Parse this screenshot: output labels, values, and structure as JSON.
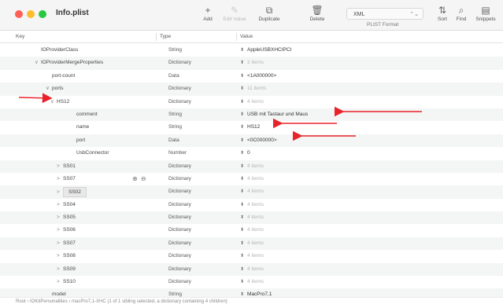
{
  "window": {
    "title": "Info.plist"
  },
  "toolbar": {
    "add": {
      "label": "Add",
      "icon": "+"
    },
    "edit_value": {
      "label": "Edit Value",
      "icon": "✎"
    },
    "duplicate": {
      "label": "Duplicate",
      "icon": "⧉"
    },
    "delete": {
      "label": "Delete",
      "icon": "🗑"
    },
    "format_value": "XML",
    "format_label": "PLIST Format",
    "sort": {
      "label": "Sort",
      "icon": "⇅"
    },
    "find": {
      "label": "Find",
      "icon": "⌕"
    },
    "snippets": {
      "label": "Snippets",
      "icon": "▤"
    }
  },
  "columns": {
    "key": "Key",
    "type": "Type",
    "value": "Value"
  },
  "rows": [
    {
      "key": "IOProviderClass",
      "disclosure": "",
      "type": "String",
      "value": "AppleUSBXHCIPCI",
      "dim": false
    },
    {
      "key": "IOProviderMergeProperties",
      "disclosure": "∨",
      "type": "Dictionary",
      "value": "2 items",
      "dim": true
    },
    {
      "key": "port-count",
      "disclosure": "",
      "type": "Data",
      "value": "<1A000000>",
      "dim": false
    },
    {
      "key": "ports",
      "disclosure": "∨",
      "type": "Dictionary",
      "value": "11 items",
      "dim": true
    },
    {
      "key": "HS12",
      "disclosure": "∨",
      "type": "Dictionary",
      "value": "4 items",
      "dim": true
    },
    {
      "key": "comment",
      "disclosure": "",
      "type": "String",
      "value": "USB mit Tastaur und Maus",
      "dim": false
    },
    {
      "key": "name",
      "disclosure": "",
      "type": "String",
      "value": "HS12",
      "dim": false
    },
    {
      "key": "port",
      "disclosure": "",
      "type": "Data",
      "value": "<0C000000>",
      "dim": false
    },
    {
      "key": "UsbConnector",
      "disclosure": "",
      "type": "Number",
      "value": "0",
      "dim": false
    },
    {
      "key": "SS01",
      "disclosure": ">",
      "type": "Dictionary",
      "value": "4 items",
      "dim": true
    },
    {
      "key": "SS07",
      "disclosure": ">",
      "type": "Dictionary",
      "value": "4 items",
      "dim": true
    },
    {
      "key": "SS02",
      "disclosure": ">",
      "type": "Dictionary",
      "value": "4 items",
      "dim": true
    },
    {
      "key": "SS04",
      "disclosure": ">",
      "type": "Dictionary",
      "value": "4 items",
      "dim": true
    },
    {
      "key": "SS05",
      "disclosure": ">",
      "type": "Dictionary",
      "value": "4 items",
      "dim": true
    },
    {
      "key": "SS06",
      "disclosure": ">",
      "type": "Dictionary",
      "value": "4 items",
      "dim": true
    },
    {
      "key": "SS07",
      "disclosure": ">",
      "type": "Dictionary",
      "value": "4 items",
      "dim": true
    },
    {
      "key": "SS08",
      "disclosure": ">",
      "type": "Dictionary",
      "value": "4 items",
      "dim": true
    },
    {
      "key": "SS09",
      "disclosure": ">",
      "type": "Dictionary",
      "value": "4 items",
      "dim": true
    },
    {
      "key": "SS10",
      "disclosure": ">",
      "type": "Dictionary",
      "value": "4 items",
      "dim": true
    },
    {
      "key": "model",
      "disclosure": "",
      "type": "String",
      "value": "MacPro7,1",
      "dim": false
    }
  ],
  "row_buttons": "⊕ ⊖",
  "status": "Root › IOKitPersonalities › macPro7,1-XHC  (1 of 1 sibling selected, a dictionary containing 4 children)",
  "colors": {
    "annotation_arrow": "#e8232a",
    "close": "#fe5f57",
    "minimize": "#febc2e",
    "maximize": "#28c840"
  }
}
